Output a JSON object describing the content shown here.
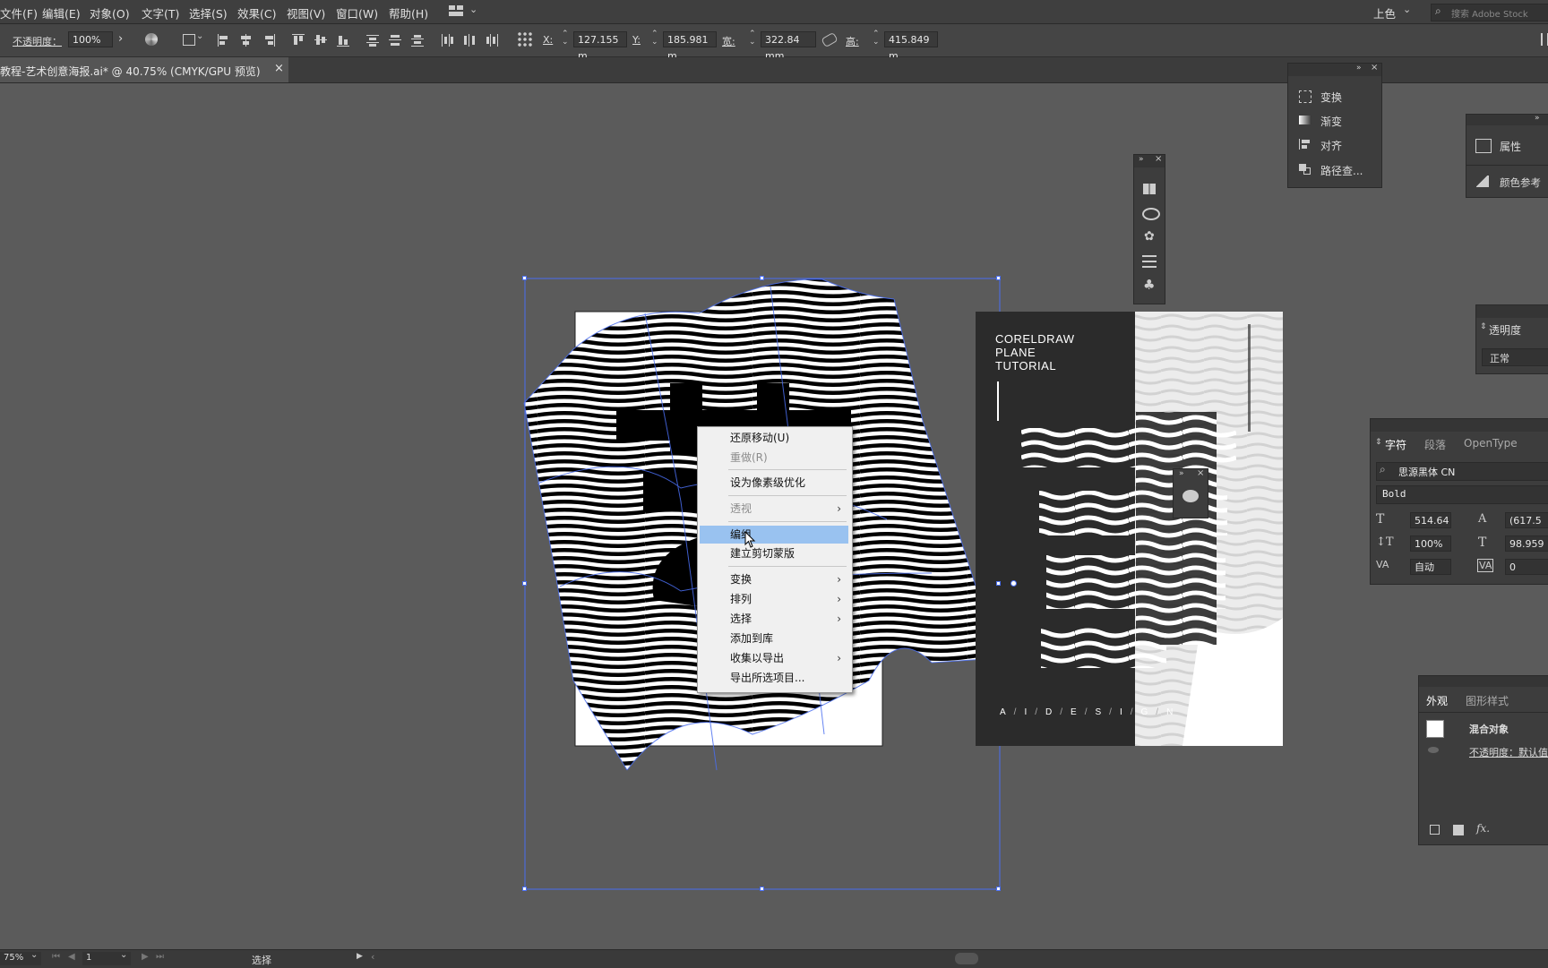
{
  "menu": [
    "文件(F)",
    "编辑(E)",
    "对象(O)",
    "文字(T)",
    "选择(S)",
    "效果(C)",
    "视图(V)",
    "窗口(W)",
    "帮助(H)"
  ],
  "workspace_label": "上色",
  "search_placeholder": "搜索 Adobe Stock",
  "control": {
    "opacity_label": "不透明度：",
    "opacity_value": "100%",
    "x_label": "X:",
    "x_value": "127.155 m",
    "y_label": "Y:",
    "y_value": "185.981 m",
    "w_label": "宽:",
    "w_value": "322.84 mm",
    "h_label": "高:",
    "h_value": "415.849 m"
  },
  "document_tab": {
    "title": "教程-艺术创意海报.ai* @ 40.75% (CMYK/GPU 预览)",
    "close": "×"
  },
  "context_menu": {
    "items": [
      {
        "label": "还原移动(U)",
        "state": "normal"
      },
      {
        "label": "重做(R)",
        "state": "disabled"
      },
      {
        "label": "设为像素级优化",
        "state": "normal"
      },
      {
        "label": "透视",
        "state": "disabled",
        "submenu": "›"
      },
      {
        "label": "编组",
        "state": "highlighted"
      },
      {
        "label": "建立剪切蒙版",
        "state": "normal"
      },
      {
        "label": "变换",
        "state": "normal",
        "submenu": "›"
      },
      {
        "label": "排列",
        "state": "normal",
        "submenu": "›"
      },
      {
        "label": "选择",
        "state": "normal",
        "submenu": "›"
      },
      {
        "label": "添加到库",
        "state": "normal"
      },
      {
        "label": "收集以导出",
        "state": "normal",
        "submenu": "›"
      },
      {
        "label": "导出所选项目...",
        "state": "normal"
      }
    ]
  },
  "poster": {
    "title_lines": [
      "CORELDRAW",
      "PLANE",
      "TUTORIAL"
    ],
    "footer": [
      "A",
      "/",
      "I",
      "/",
      "D",
      "/",
      "E",
      "/",
      "S",
      "/",
      "I",
      "/",
      "G",
      "/",
      "N"
    ]
  },
  "panel_tools": {
    "items": [
      "变换",
      "渐变",
      "对齐",
      "路径查..."
    ],
    "close": "×"
  },
  "panel_properties": {
    "items": [
      "属性",
      "颜色参考"
    ]
  },
  "panel_transparency": {
    "title": "透明度",
    "mode": "正常"
  },
  "panel_character": {
    "tabs": [
      "字符",
      "段落",
      "OpenType"
    ],
    "font": "思源黑体 CN",
    "style": "Bold",
    "size": "514.64",
    "leading": "(617.5",
    "vscale": "100%",
    "hscale": "98.959",
    "kerning": "自动",
    "tracking": "0"
  },
  "panel_appearance": {
    "tabs": [
      "外观",
      "图形样式"
    ],
    "object_label": "混合对象",
    "opacity_row": "不透明度：默认值",
    "fx": "fx."
  },
  "status": {
    "zoom": "75%",
    "artboard": "1",
    "tool": "选择"
  },
  "colors": {
    "ui_dark": "#3d3d3d",
    "canvas": "#5b5b5b",
    "selection": "#4a6ef0",
    "menu_highlight": "#99c2f0"
  }
}
